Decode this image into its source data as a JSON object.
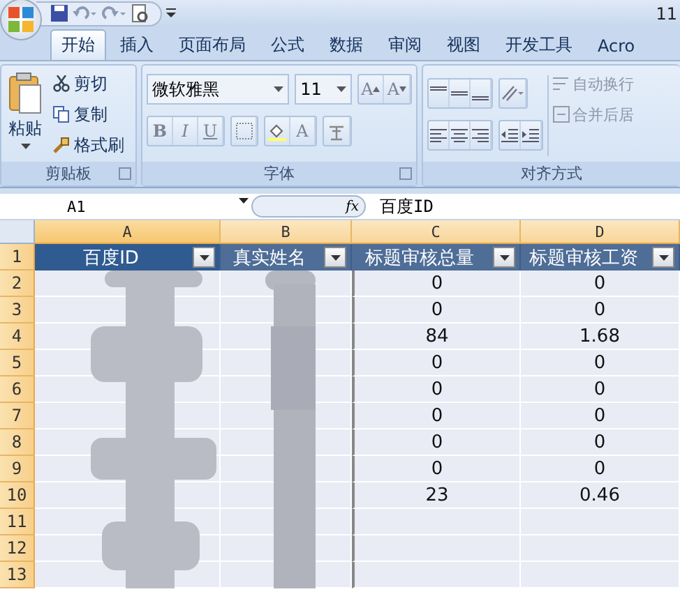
{
  "title_bar": {
    "title": "11"
  },
  "tabs": [
    {
      "label": "开始",
      "selected": true
    },
    {
      "label": "插入",
      "selected": false
    },
    {
      "label": "页面布局",
      "selected": false
    },
    {
      "label": "公式",
      "selected": false
    },
    {
      "label": "数据",
      "selected": false
    },
    {
      "label": "审阅",
      "selected": false
    },
    {
      "label": "视图",
      "selected": false
    },
    {
      "label": "开发工具",
      "selected": false
    },
    {
      "label": "Acro",
      "selected": false
    }
  ],
  "clipboard": {
    "label": "剪贴板",
    "paste": "粘贴",
    "cut": "剪切",
    "copy": "复制",
    "format_painter": "格式刷"
  },
  "font": {
    "label": "字体",
    "font_name": "微软雅黑",
    "font_size": "11",
    "grow_font": "A",
    "shrink_font": "A",
    "bold": "B",
    "italic": "I",
    "underline": "U",
    "font_color": "A"
  },
  "alignment": {
    "label": "对齐方式",
    "wrap_text": "自动换行",
    "merge_center": "合并后居"
  },
  "formula_bar": {
    "name_box": "A1",
    "fx": "fx",
    "value": "百度ID"
  },
  "sheet": {
    "columns": [
      "A",
      "B",
      "C",
      "D"
    ],
    "header_row": "1",
    "header": [
      "百度ID",
      "真实姓名",
      "标题审核总量",
      "标题审核工资"
    ],
    "rows": [
      {
        "number": "2",
        "c": "0",
        "d": "0"
      },
      {
        "number": "3",
        "c": "0",
        "d": "0"
      },
      {
        "number": "4",
        "c": "84",
        "d": "1.68"
      },
      {
        "number": "5",
        "c": "0",
        "d": "0"
      },
      {
        "number": "6",
        "c": "0",
        "d": "0"
      },
      {
        "number": "7",
        "c": "0",
        "d": "0"
      },
      {
        "number": "8",
        "c": "0",
        "d": "0"
      },
      {
        "number": "9",
        "c": "0",
        "d": "0"
      },
      {
        "number": "10",
        "c": "23",
        "d": "0.46"
      },
      {
        "number": "11"
      },
      {
        "number": "12"
      },
      {
        "number": "13"
      }
    ]
  }
}
